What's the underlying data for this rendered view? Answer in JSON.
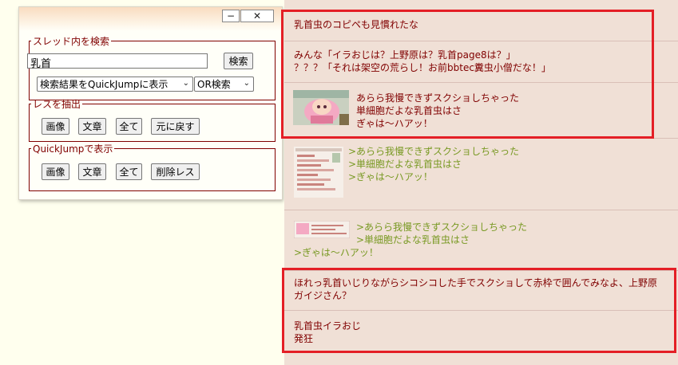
{
  "panel": {
    "minimize_label": "−",
    "close_label": "✕",
    "search_group_legend": "スレッド内を検索",
    "search_value": "乳首",
    "search_button": "検索",
    "display_select": "検索結果をQuickJumpに表示",
    "mode_select": "OR検索",
    "extract_group_legend": "レスを抽出",
    "extract_buttons": [
      "画像",
      "文章",
      "全て",
      "元に戻す"
    ],
    "quickjump_group_legend": "QuickJumpで表示",
    "quickjump_buttons": [
      "画像",
      "文章",
      "全て",
      "削除レス"
    ]
  },
  "thread": {
    "posts": [
      {
        "lines": [
          "乳首虫のコピペも見慣れたな"
        ]
      },
      {
        "lines": [
          "みんな「イラおじは？上野原は？乳首page8は？」",
          "？？？「それは架空の荒らし！お前bbtec糞虫小僧だな！」"
        ]
      },
      {
        "lines": [
          "あらら我慢できずスクショしちゃった",
          "単細胞だよな乳首虫はさ",
          "ぎゃは～ハアッ！"
        ],
        "thumbnail": "character-image"
      },
      {
        "lines": [
          ">あらら我慢できずスクショしちゃった",
          ">単細胞だよな乳首虫はさ",
          ">ぎゃは～ハアッ！"
        ],
        "thumbnail": "screenshot-image"
      },
      {
        "lines": [
          ">あらら我慢できずスクショしちゃった",
          ">単細胞だよな乳首虫はさ",
          ">ぎゃは～ハアッ！"
        ],
        "thumbnail": "small-screenshot-image"
      },
      {
        "lines": [
          "ほれっ乳首いじりながらシコシコした手でスクショして赤枠で囲んでみなよ、上野原",
          "ガイジさん？"
        ]
      },
      {
        "lines": [
          "乳首虫イラおじ",
          "発狂"
        ]
      }
    ]
  },
  "colors": {
    "thread_bg": "#f0e0d6",
    "text": "#800000",
    "quote": "#789922",
    "highlight_box": "#e41f26",
    "page_bg": "#ffffee"
  }
}
